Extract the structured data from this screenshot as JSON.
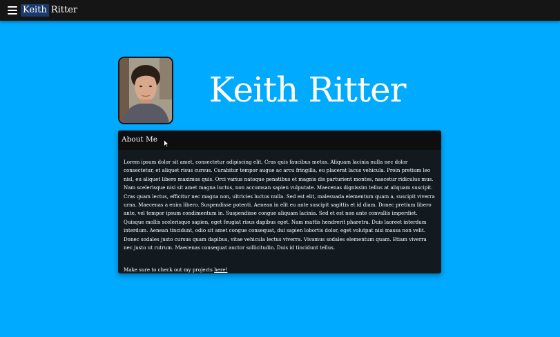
{
  "navbar": {
    "menu_icon": "hamburger-menu-icon",
    "brand_first": "Keith",
    "brand_last": "Ritter"
  },
  "hero": {
    "title": "Keith Ritter",
    "avatar_icon": "profile-photo"
  },
  "about": {
    "header": "About Me",
    "body": "Lorem ipsum dolor sit amet, consectetur adipiscing elit. Cras quis faucibus metus. Aliquam lacinia nulla nec dolor consectetur, et aliquet risus cursus. Curabitur tempor augue ac arcu fringilla, eu placerat lacus vehicula. Proin pretium leo nisl, eu aliquet libero maximus quis. Orci varius natoque penatibus et magnis dis parturient montes, nascetur ridiculus mus. Nam scelerisque nisi sit amet magna luctus, non accumsan sapien vulputate. Maecenas dignissim tellus at aliquam suscipit. Cras quam lectus, efficitur nec magna non, ultricies luctus nulla. Sed est elit, malesuada elementum quam a, suscipit viverra urna. Maecenas a enim libero. Suspendisse potenti. Aenean in elit eu ante suscipit sagittis et id diam. Donec pretium libero ante, vel tempor ipsum condimentum in. Suspendisse congue aliquam lacinia. Sed et est non ante convallis imperdiet. Quisque mollis scelerisque sapien, eget feugiat risus dapibus eget. Nam mattis hendrerit pharetra. Duis laoreet interdum interdum. Aenean tincidunt, odio sit amet congue consequat, dui sapien lobortis dolor, eget volutpat nisi massa non velit. Donec sodales justo cursus quam dapibus, vitae vehicula lectus viverra. Vivamus sodales elementum quam. Etiam viverra nec justo ut rutrum. Maecenas consequat auctor sollicitudin. Duis id tincidunt tellus.",
    "projects_prefix": "Make sure to check out my projects ",
    "projects_link": "here!"
  },
  "colors": {
    "background": "#00aaff",
    "navbar": "#151515",
    "card": "#121a20",
    "card_header": "#0e0e0e",
    "brand_highlight": "#1a3a6e"
  }
}
